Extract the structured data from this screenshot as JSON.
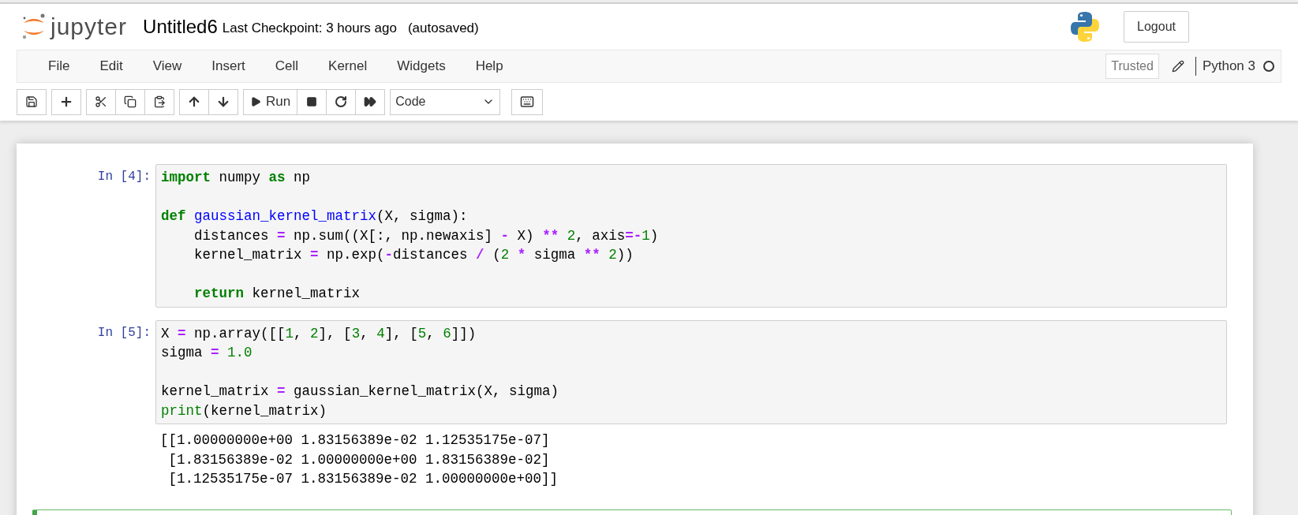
{
  "header": {
    "logo_text": "jupyter",
    "title": "Untitled6",
    "checkpoint": "Last Checkpoint: 3 hours ago",
    "autosave": "(autosaved)",
    "logout": "Logout"
  },
  "menu": [
    "File",
    "Edit",
    "View",
    "Insert",
    "Cell",
    "Kernel",
    "Widgets",
    "Help"
  ],
  "status": {
    "trusted": "Trusted",
    "kernel": "Python 3",
    "kernel_busy": false
  },
  "toolbar": {
    "run_label": "Run",
    "cell_type": "Code"
  },
  "cells": [
    {
      "prompt": "In [4]:",
      "selected": false,
      "lines": [
        {
          "tokens": [
            {
              "kind": "keyword",
              "text": "import"
            },
            {
              "kind": "name",
              "text": " numpy "
            },
            {
              "kind": "keyword",
              "text": "as"
            },
            {
              "kind": "name",
              "text": " np"
            }
          ]
        },
        {
          "blank": true
        },
        {
          "tokens": [
            {
              "kind": "keyword",
              "text": "def"
            },
            {
              "kind": "function",
              "text": " gaussian_kernel_matrix"
            },
            {
              "kind": "name",
              "text": "(X, sigma):"
            }
          ]
        },
        {
          "tokens": [
            {
              "kind": "name",
              "text": "    distances "
            },
            {
              "kind": "operator",
              "text": "="
            },
            {
              "kind": "name",
              "text": " np.sum((X[:, np.newaxis] "
            },
            {
              "kind": "operator",
              "text": "-"
            },
            {
              "kind": "name",
              "text": " X) "
            },
            {
              "kind": "operator",
              "text": "**"
            },
            {
              "kind": "number",
              "text": " 2"
            },
            {
              "kind": "name",
              "text": ", axis"
            },
            {
              "kind": "operator",
              "text": "=-"
            },
            {
              "kind": "number",
              "text": "1"
            },
            {
              "kind": "name",
              "text": ")"
            }
          ]
        },
        {
          "tokens": [
            {
              "kind": "name",
              "text": "    kernel_matrix "
            },
            {
              "kind": "operator",
              "text": "="
            },
            {
              "kind": "name",
              "text": " np.exp("
            },
            {
              "kind": "operator",
              "text": "-"
            },
            {
              "kind": "name",
              "text": "distances "
            },
            {
              "kind": "operator",
              "text": "/"
            },
            {
              "kind": "name",
              "text": " ("
            },
            {
              "kind": "number",
              "text": "2"
            },
            {
              "kind": "operator",
              "text": " *"
            },
            {
              "kind": "name",
              "text": " sigma "
            },
            {
              "kind": "operator",
              "text": "**"
            },
            {
              "kind": "number",
              "text": " 2"
            },
            {
              "kind": "name",
              "text": "))"
            }
          ]
        },
        {
          "blank": true
        },
        {
          "tokens": [
            {
              "kind": "keyword",
              "text": "    return"
            },
            {
              "kind": "name",
              "text": " kernel_matrix"
            }
          ]
        }
      ]
    },
    {
      "prompt": "In [5]:",
      "selected": false,
      "lines": [
        {
          "tokens": [
            {
              "kind": "name",
              "text": "X "
            },
            {
              "kind": "operator",
              "text": "="
            },
            {
              "kind": "name",
              "text": " np.array([["
            },
            {
              "kind": "number",
              "text": "1"
            },
            {
              "kind": "name",
              "text": ", "
            },
            {
              "kind": "number",
              "text": "2"
            },
            {
              "kind": "name",
              "text": "], ["
            },
            {
              "kind": "number",
              "text": "3"
            },
            {
              "kind": "name",
              "text": ", "
            },
            {
              "kind": "number",
              "text": "4"
            },
            {
              "kind": "name",
              "text": "], ["
            },
            {
              "kind": "number",
              "text": "5"
            },
            {
              "kind": "name",
              "text": ", "
            },
            {
              "kind": "number",
              "text": "6"
            },
            {
              "kind": "name",
              "text": "]])"
            }
          ]
        },
        {
          "tokens": [
            {
              "kind": "name",
              "text": "sigma "
            },
            {
              "kind": "operator",
              "text": "="
            },
            {
              "kind": "number",
              "text": " 1.0"
            }
          ]
        },
        {
          "blank": true
        },
        {
          "tokens": [
            {
              "kind": "name",
              "text": "kernel_matrix "
            },
            {
              "kind": "operator",
              "text": "="
            },
            {
              "kind": "name",
              "text": " gaussian_kernel_matrix(X, sigma)"
            }
          ]
        },
        {
          "tokens": [
            {
              "kind": "builtin",
              "text": "print"
            },
            {
              "kind": "name",
              "text": "(kernel_matrix)"
            }
          ]
        }
      ],
      "output": [
        "[[1.00000000e+00 1.83156389e-02 1.12535175e-07]",
        " [1.83156389e-02 1.00000000e+00 1.83156389e-02]",
        " [1.12535175e-07 1.83156389e-02 1.00000000e+00]]"
      ]
    },
    {
      "selected": true
    }
  ]
}
